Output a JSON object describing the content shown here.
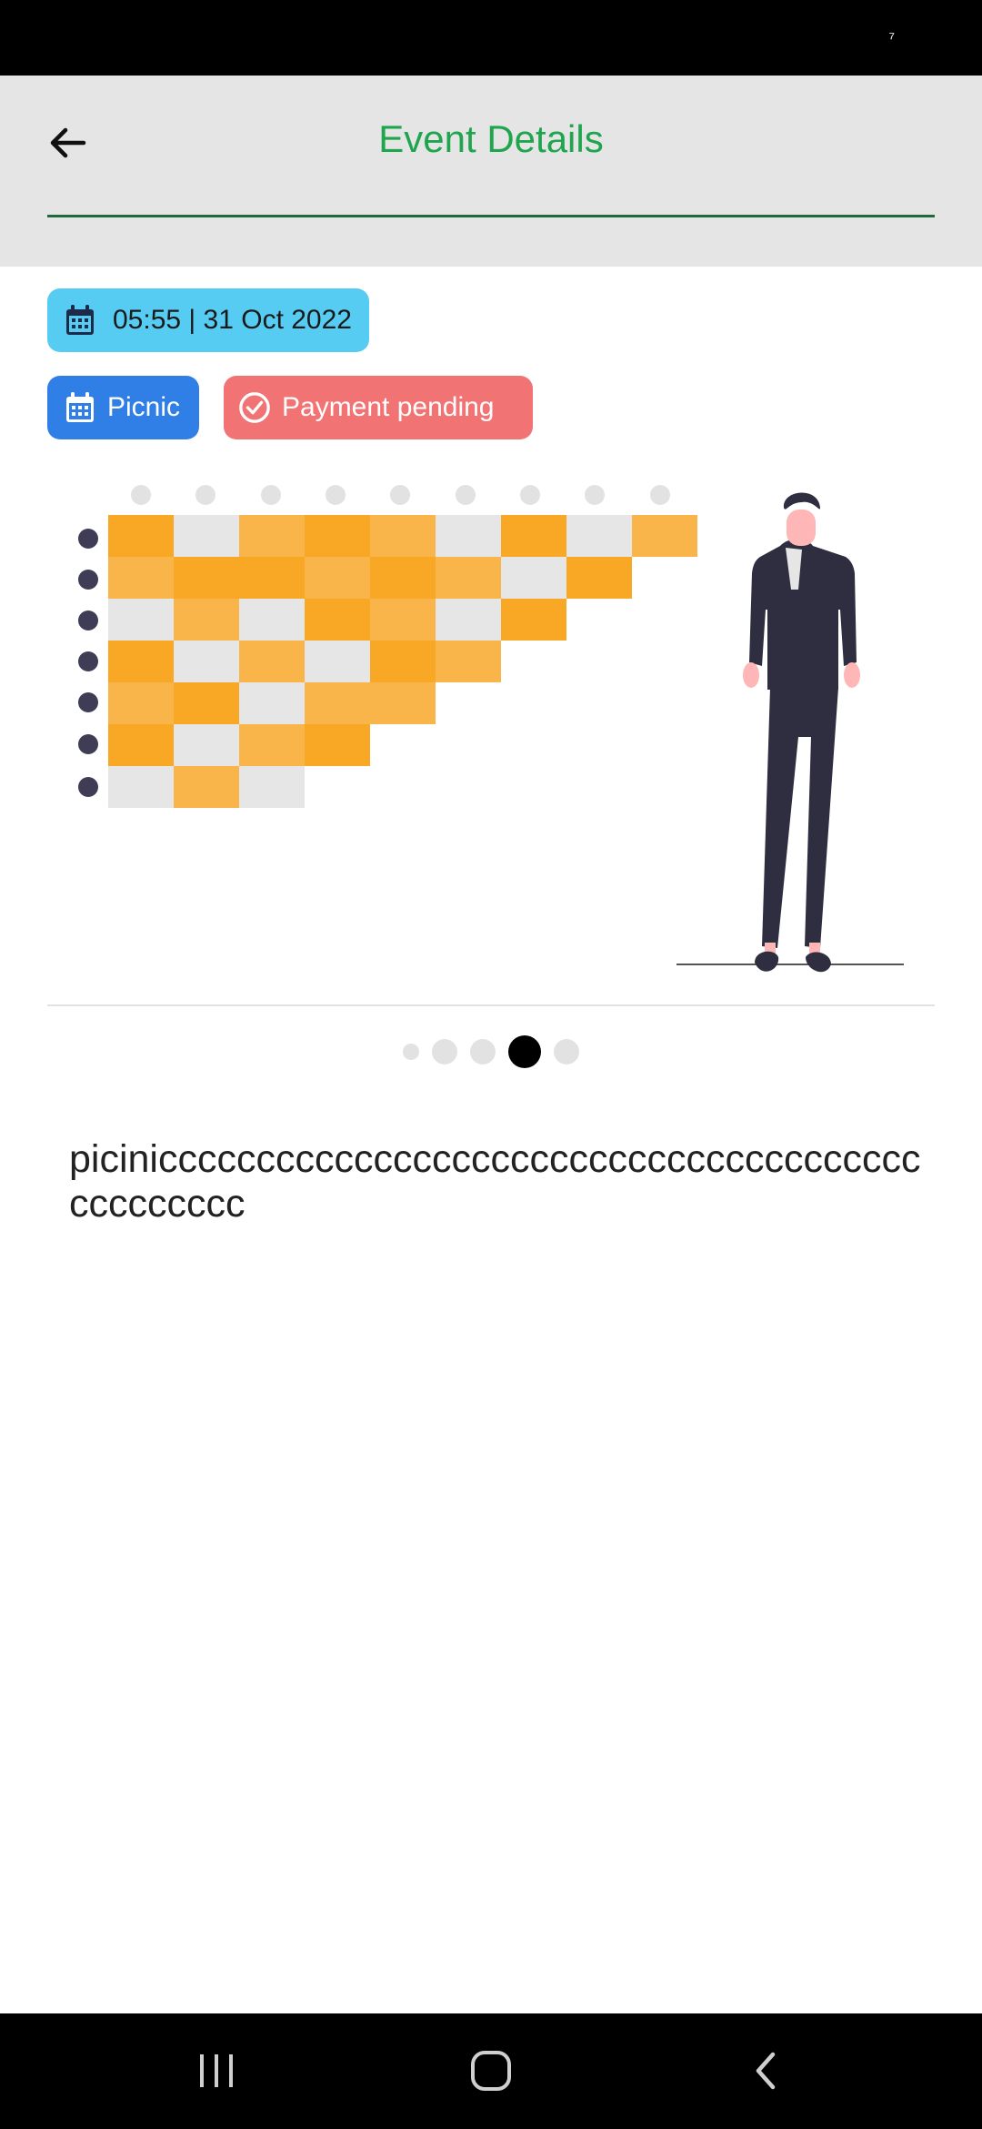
{
  "status_bar": {
    "text": "⁷"
  },
  "header": {
    "title": "Event Details",
    "back_icon": "arrow-left-icon",
    "title_color": "#1ea54d"
  },
  "event": {
    "datetime": "05:55 | 31 Oct 2022",
    "category": "Picnic",
    "payment_status": "Payment pending",
    "description": "picinicccccccccccccccccccccccccccccccccccccccccccccccc"
  },
  "colors": {
    "datetime_chip": "#56ccf2",
    "category_chip": "#2f7fe6",
    "status_chip": "#f27374",
    "header_bg": "#e5e5e5",
    "accent_orange": "#f9a825"
  },
  "carousel": {
    "page_count": 5,
    "active_index": 3
  },
  "nav_bar": {
    "recents_icon": "recents-icon",
    "home_icon": "home-icon",
    "back_icon": "back-chevron-icon"
  }
}
